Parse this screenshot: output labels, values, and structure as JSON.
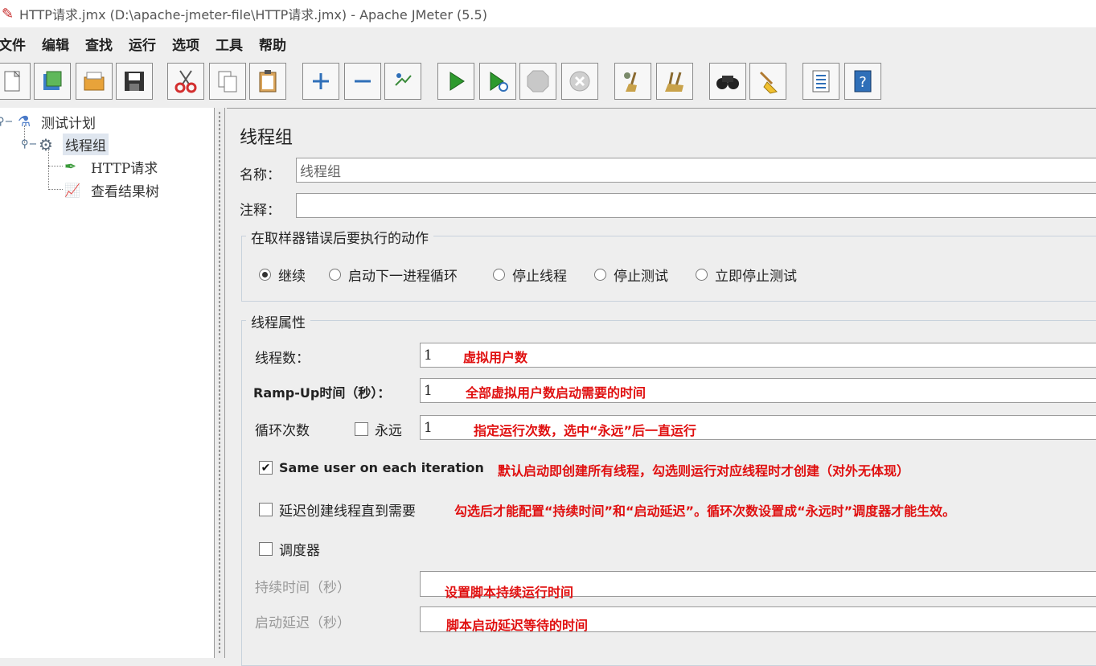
{
  "window": {
    "title": "HTTP请求.jmx (D:\\apache-jmeter-file\\HTTP请求.jmx) - Apache JMeter (5.5)"
  },
  "menu": [
    "文件",
    "编辑",
    "查找",
    "运行",
    "选项",
    "工具",
    "帮助"
  ],
  "toolbar": [
    {
      "icon": "new-icon"
    },
    {
      "icon": "templates-icon"
    },
    {
      "icon": "open-icon"
    },
    {
      "icon": "save-icon"
    },
    {
      "icon": "cut-icon"
    },
    {
      "icon": "copy-icon"
    },
    {
      "icon": "paste-icon"
    },
    {
      "icon": "expand-icon"
    },
    {
      "icon": "collapse-icon"
    },
    {
      "icon": "toggle-icon"
    },
    {
      "icon": "start-icon"
    },
    {
      "icon": "start-no-pause-icon"
    },
    {
      "icon": "stop-icon"
    },
    {
      "icon": "shutdown-icon"
    },
    {
      "icon": "clear-icon"
    },
    {
      "icon": "clear-all-icon"
    },
    {
      "icon": "search-icon"
    },
    {
      "icon": "reset-search-icon"
    },
    {
      "icon": "function-helper-icon"
    },
    {
      "icon": "help-icon"
    }
  ],
  "tree": {
    "test_plan": "测试计划",
    "thread_group": "线程组",
    "http_request": "HTTP请求",
    "results_tree": "查看结果树"
  },
  "panel": {
    "title": "线程组",
    "name_label": "名称：",
    "name_value": "线程组",
    "comment_label": "注释：",
    "comment_value": "",
    "error_group_title": "在取样器错误后要执行的动作",
    "error_actions": [
      {
        "label": "继续",
        "selected": true
      },
      {
        "label": "启动下一进程循环",
        "selected": false
      },
      {
        "label": "停止线程",
        "selected": false
      },
      {
        "label": "停止测试",
        "selected": false
      },
      {
        "label": "立即停止测试",
        "selected": false
      }
    ],
    "props_group_title": "线程属性",
    "threads_label": "线程数：",
    "threads_value": "1",
    "rampup_label": "Ramp-Up时间（秒）：",
    "rampup_value": "1",
    "loop_label": "循环次数",
    "forever_label": "永远",
    "forever_checked": false,
    "loop_value": "1",
    "same_user_label": "Same user on each iteration",
    "same_user_checked": true,
    "delay_create_label": "延迟创建线程直到需要",
    "delay_create_checked": false,
    "scheduler_label": "调度器",
    "scheduler_checked": false,
    "duration_label": "持续时间（秒）",
    "duration_value": "",
    "startup_delay_label": "启动延迟（秒）",
    "startup_delay_value": ""
  },
  "annotations": {
    "threads": "虚拟用户数",
    "rampup": "全部虚拟用户数启动需要的时间",
    "loop": "指定运行次数，选中“永远”后一直运行",
    "same_user": "默认启动即创建所有线程，勾选则运行对应线程时才创建（对外无体现）",
    "delay_create": "勾选后才能配置“持续时间”和“启动延迟”。循环次数设置成“永远时”调度器才能生效。",
    "duration": "设置脚本持续运行时间",
    "startup_delay": "脚本启动延迟等待的时间"
  }
}
